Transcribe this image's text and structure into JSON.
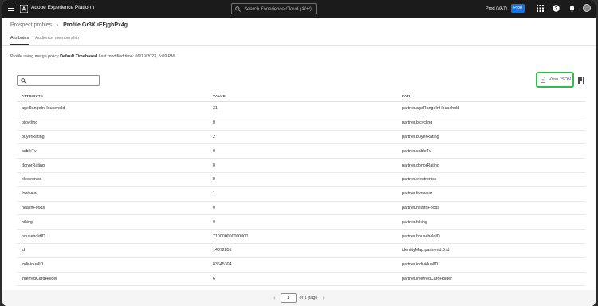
{
  "topbar": {
    "app_name": "Adobe Experience Platform",
    "search_placeholder": "Search Experience Cloud (⌘+/)",
    "sandbox": "Prod (VA7)",
    "badge": "Prod",
    "accent": "#1473e6"
  },
  "breadcrumb": {
    "parent": "Prospect profiles",
    "current": "Profile Gr3XuEFjghPx4g"
  },
  "tabs": [
    "Attributes",
    "Audience membership"
  ],
  "policy": {
    "prefix": "Profile using merge policy",
    "policy_name": "Default Timebased",
    "modified": "Last modified time: 06/19/2023, 5:09 PM"
  },
  "toolbar": {
    "view_json_label": "View JSON",
    "highlight": "#2dbe48"
  },
  "table": {
    "headers": [
      "ATTRIBUTE",
      "VALUE",
      "PATH"
    ],
    "rows": [
      [
        "ageRangeInHousehold",
        "31",
        "partner.ageRangeInHousehold"
      ],
      [
        "bicycling",
        "0",
        "partner.bicycling"
      ],
      [
        "buyerRating",
        "2",
        "partner.buyerRating"
      ],
      [
        "cableTv",
        "0",
        "partner.cableTv"
      ],
      [
        "donorRating",
        "0",
        "partner.donorRating"
      ],
      [
        "electronics",
        "0",
        "partner.electronics"
      ],
      [
        "footwear",
        "1",
        "partner.footwear"
      ],
      [
        "healthFoods",
        "0",
        "partner.healthFoods"
      ],
      [
        "hiking",
        "0",
        "partner.hiking"
      ],
      [
        "householdID",
        "710000000000000",
        "partner.householdID"
      ],
      [
        "id",
        "14872851",
        "identityMap.partnerid.0.id"
      ],
      [
        "individualID",
        "83645304",
        "partner.individualID"
      ],
      [
        "inferredCardHolder",
        "6",
        "partner.inferredCardHolder"
      ]
    ]
  },
  "pagination": {
    "page": "1",
    "of_text": "of 1 page"
  }
}
